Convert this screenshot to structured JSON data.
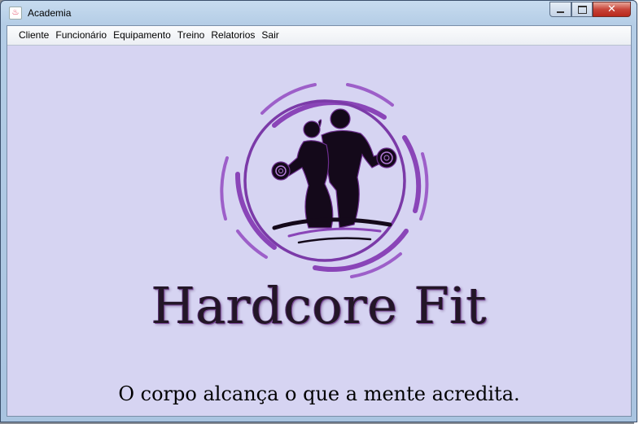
{
  "window": {
    "title": "Academia",
    "app_icon": "java-cup-icon"
  },
  "controls": {
    "close_glyph": "✕"
  },
  "menu": {
    "items": [
      {
        "label": "Cliente"
      },
      {
        "label": "Funcionário"
      },
      {
        "label": "Equipamento"
      },
      {
        "label": "Treino"
      },
      {
        "label": "Relatorios"
      },
      {
        "label": "Sair"
      }
    ]
  },
  "splash": {
    "brand": "Hardcore Fit",
    "slogan": "O corpo alcança o que a mente acredita.",
    "logo_icon": "fitness-couple-dumbbell-icon",
    "colors": {
      "background": "#d6d4f2",
      "accent": "#8a45b8",
      "text": "#231627"
    }
  }
}
